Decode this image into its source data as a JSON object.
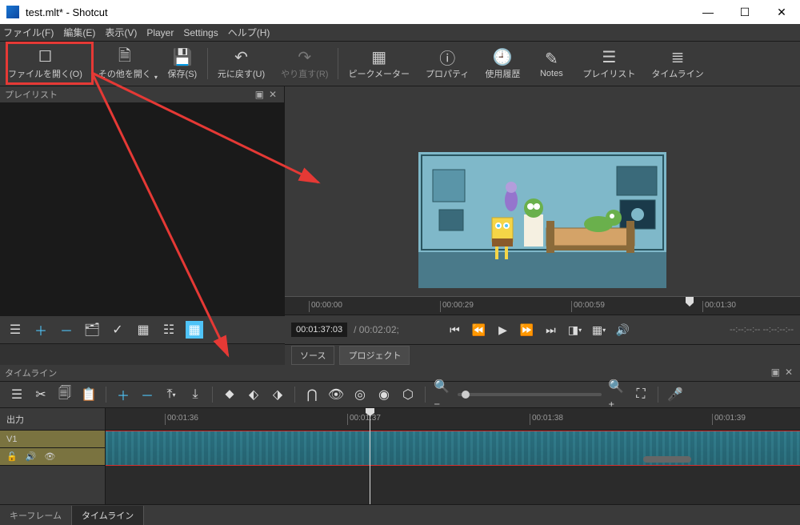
{
  "title": "test.mlt* - Shotcut",
  "menubar": {
    "file": "ファイル(F)",
    "edit": "編集(E)",
    "view": "表示(V)",
    "player": "Player",
    "settings": "Settings",
    "help": "ヘルプ(H)"
  },
  "toolbar": {
    "open_file": "ファイルを開く(O)",
    "open_other": "その他を開く",
    "save": "保存(S)",
    "undo": "元に戻す(U)",
    "redo": "やり直す(R)",
    "peak_meter": "ピークメーター",
    "properties": "プロパティ",
    "history": "使用履歴",
    "notes": "Notes",
    "playlist": "プレイリスト",
    "timeline": "タイムライン"
  },
  "playlist_panel_title": "プレイリスト",
  "preview_ruler": {
    "t0": "00:00:00",
    "t1": "00:00:29",
    "t2": "00:00:59",
    "t3": "00:01:30"
  },
  "playbar": {
    "pos": "00:01:37:03",
    "dur": "00:02:02;",
    "dashes": "--:--:--:--  --:--:--:--"
  },
  "source_tab": "ソース",
  "project_tab": "プロジェクト",
  "timeline_title": "タイムライン",
  "timeline": {
    "output_label": "出力",
    "track_label": "V1",
    "t0": "00:01:36",
    "t1": "00:01:37",
    "t2": "00:01:38",
    "t3": "00:01:39"
  },
  "bottom_tabs": {
    "keyframes": "キーフレーム",
    "timeline": "タイムライン"
  }
}
